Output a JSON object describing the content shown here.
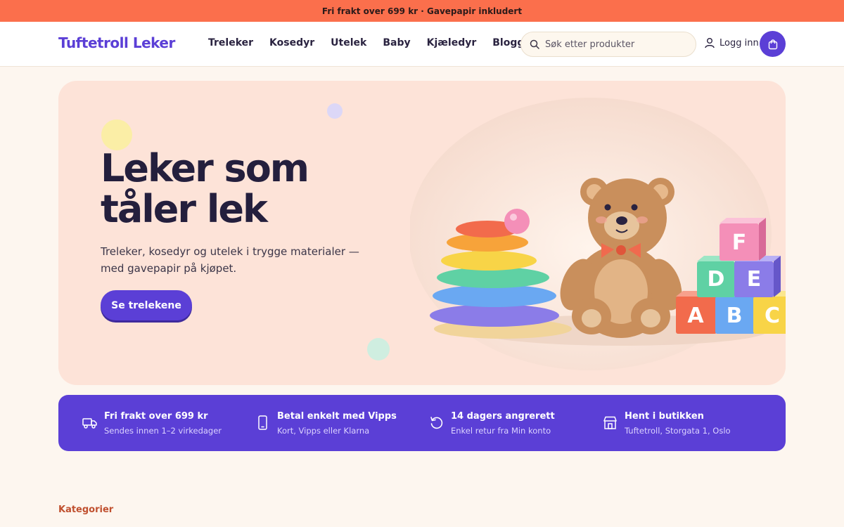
{
  "promo": {
    "text": "Fri frakt over 699 kr · Gavepapir inkludert"
  },
  "header": {
    "logo": "Tuftetroll Leker",
    "nav": [
      "Treleker",
      "Kosedyr",
      "Utelek",
      "Baby",
      "Kjæledyr",
      "Blogg"
    ],
    "search": {
      "placeholder": "Søk etter produkter",
      "icon": "search-icon"
    },
    "login_label": "Logg inn",
    "colors": {
      "brand": "#5b3fd6",
      "promo": "#fb6f4c"
    }
  },
  "hero": {
    "title_line1": "Leker som",
    "title_line2": "tåler lek",
    "subtitle": "Treleker, kosedyr og utelek i trygge materialer — med gavepapir på kjøpet.",
    "cta_label": "Se trelekene",
    "blocks": [
      "A",
      "B",
      "C",
      "D",
      "E",
      "F"
    ],
    "background": "#fde3d8"
  },
  "features": [
    {
      "icon": "truck-icon",
      "title": "Fri frakt over 699 kr",
      "subtitle": "Sendes innen 1–2 virkedager"
    },
    {
      "icon": "phone-icon",
      "title": "Betal enkelt med Vipps",
      "subtitle": "Kort, Vipps eller Klarna"
    },
    {
      "icon": "return-icon",
      "title": "14 dagers angrerett",
      "subtitle": "Enkel retur fra Min konto"
    },
    {
      "icon": "store-icon",
      "title": "Hent i butikken",
      "subtitle": "Tuftetroll, Storgata 1, Oslo"
    }
  ],
  "sections": {
    "categories_label": "Kategorier"
  }
}
